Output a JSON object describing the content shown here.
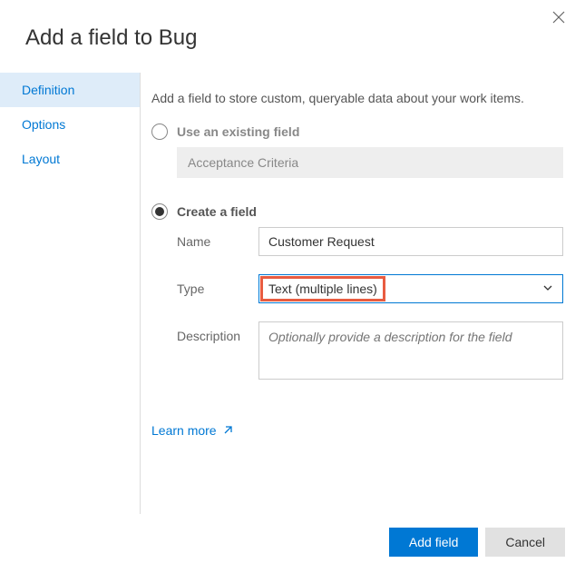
{
  "title": "Add a field to Bug",
  "sidebar": {
    "items": [
      {
        "label": "Definition",
        "selected": true
      },
      {
        "label": "Options",
        "selected": false
      },
      {
        "label": "Layout",
        "selected": false
      }
    ]
  },
  "intro": "Add a field to store custom, queryable data about your work items.",
  "existing": {
    "radio_label": "Use an existing field",
    "value": "Acceptance Criteria"
  },
  "create": {
    "radio_label": "Create a field",
    "name_label": "Name",
    "name_value": "Customer Request",
    "type_label": "Type",
    "type_value": "Text (multiple lines)",
    "description_label": "Description",
    "description_placeholder": "Optionally provide a description for the field"
  },
  "learn_more": "Learn more",
  "buttons": {
    "primary": "Add field",
    "secondary": "Cancel"
  }
}
